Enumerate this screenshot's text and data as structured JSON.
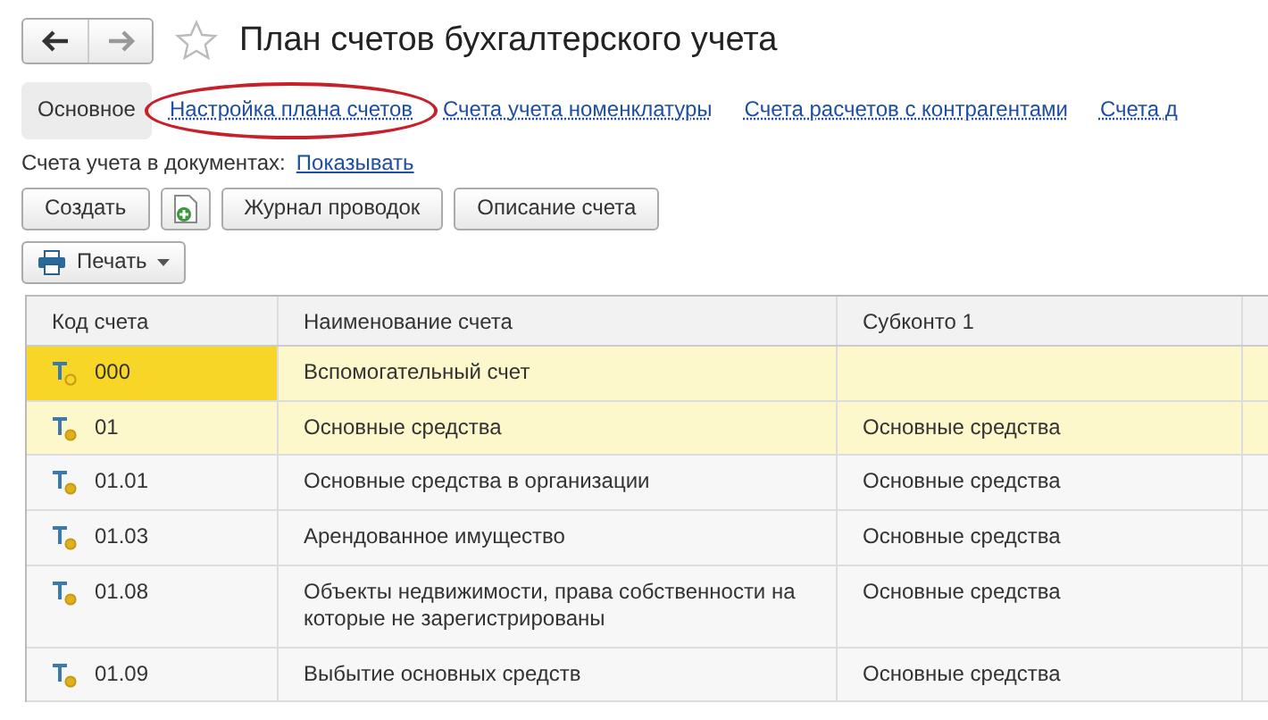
{
  "window": {
    "title": "План счетов бухгалтерского учета"
  },
  "tabs": [
    {
      "label": "Основное",
      "selected": true,
      "circled": false
    },
    {
      "label": "Настройка плана счетов",
      "selected": false,
      "circled": true
    },
    {
      "label": "Счета учета номенклатуры",
      "selected": false,
      "circled": false
    },
    {
      "label": "Счета расчетов с контрагентами",
      "selected": false,
      "circled": false
    },
    {
      "label": "Счета д",
      "selected": false,
      "circled": false
    }
  ],
  "documents_accounts": {
    "label": "Счета учета в документах:",
    "link": "Показывать"
  },
  "toolbar": {
    "buttons": [
      {
        "kind": "text",
        "label": "Создать"
      },
      {
        "kind": "icon"
      },
      {
        "kind": "text",
        "label": "Журнал проводок"
      },
      {
        "kind": "text",
        "label": "Описание счета"
      }
    ],
    "print_button": {
      "label": "Печать"
    }
  },
  "table": {
    "columns": [
      "Код счета",
      "Наименование счета",
      "Субконто 1"
    ],
    "rows": [
      {
        "code": "000",
        "name": "Вспомогательный счет",
        "subconto_1": "",
        "selected": true,
        "highlighted": true,
        "marker_filled": false
      },
      {
        "code": "01",
        "name": "Основные средства",
        "subconto_1": "Основные средства",
        "selected": false,
        "highlighted": true,
        "marker_filled": true
      },
      {
        "code": "01.01",
        "name": "Основные средства в организации",
        "subconto_1": "Основные средства",
        "selected": false,
        "highlighted": false,
        "marker_filled": true
      },
      {
        "code": "01.03",
        "name": "Арендованное имущество",
        "subconto_1": "Основные средства",
        "selected": false,
        "highlighted": false,
        "marker_filled": true
      },
      {
        "code": "01.08",
        "name": "Объекты недвижимости, права собственности на которые не зарегистрированы",
        "subconto_1": "Основные средства",
        "selected": false,
        "highlighted": false,
        "marker_filled": true
      },
      {
        "code": "01.09",
        "name": "Выбытие основных средств",
        "subconto_1": "Основные средства",
        "selected": false,
        "highlighted": false,
        "marker_filled": true
      }
    ]
  }
}
